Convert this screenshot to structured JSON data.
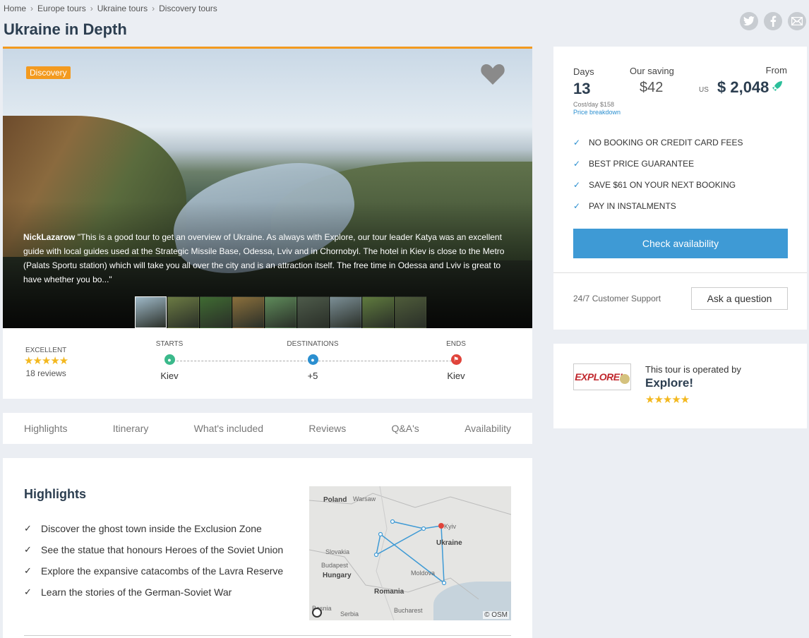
{
  "breadcrumb": [
    "Home",
    "Europe tours",
    "Ukraine tours",
    "Discovery tours"
  ],
  "page_title": "Ukraine in Depth",
  "social": [
    "twitter-icon",
    "facebook-icon",
    "email-icon"
  ],
  "hero": {
    "badge": "Discovery",
    "review_author": "NickLazarow",
    "review_text": "\"This is a good tour to get an overview of Ukraine. As always with Explore, our tour leader Katya was an excellent guide with local guides used at the Strategic Missile Base, Odessa, Lviv and in Chornobyl. The hotel in Kiev is close to the Metro (Palats Sportu station) which will take you all over the city and is an attraction itself. The free time in Odessa and Lviv is great to have whether you bo...\"",
    "thumbnail_colors": [
      "#9fb9c8",
      "#6b7a43",
      "#3f6a32",
      "#8a6f3c",
      "#5e8a5a",
      "#4d5a4a",
      "#7b8e95",
      "#5f7a3e",
      "#4e5b3a"
    ]
  },
  "info": {
    "rating_label": "EXCELLENT",
    "rating_value": 4.5,
    "stars": "★★★★★",
    "reviews_count": "18 reviews",
    "starts_label": "STARTS",
    "starts_value": "Kiev",
    "destinations_label": "DESTINATIONS",
    "destinations_value": "+5",
    "ends_label": "ENDS",
    "ends_value": "Kiev"
  },
  "tabs": [
    "Highlights",
    "Itinerary",
    "What's included",
    "Reviews",
    "Q&A's",
    "Availability"
  ],
  "highlights": {
    "title": "Highlights",
    "items": [
      "Discover the ghost town inside the Exclusion Zone",
      "See the statue that honours Heroes of the Soviet Union",
      "Explore the expansive catacombs of the Lavra Reserve",
      "Learn the stories of the German-Soviet War"
    ],
    "check": "✓"
  },
  "map": {
    "labels": [
      "Poland",
      "Warsaw",
      "Kyiv",
      "Ukraine",
      "Slovakia",
      "Budapest",
      "Hungary",
      "Moldova",
      "Romania",
      "Bucharest",
      "Serbia",
      "Bosnia"
    ],
    "attribution": "© OSM"
  },
  "price": {
    "days_label": "Days",
    "days": "13",
    "cost_per_day": "Cost/day $158",
    "breakdown": "Price breakdown",
    "saving_label": "Our saving",
    "saving": "$42",
    "from_label": "From",
    "currency": "US",
    "price": "$ 2,048",
    "perks": [
      "NO BOOKING OR CREDIT CARD FEES",
      "BEST PRICE GUARANTEE",
      "SAVE $61 ON YOUR NEXT BOOKING",
      "PAY IN INSTALMENTS"
    ],
    "check_availability": "Check availability",
    "support": "24/7 Customer Support",
    "ask": "Ask a question"
  },
  "operator": {
    "logo_text": "EXPLORE!",
    "intro": "This tour is operated by",
    "name": "Explore!",
    "stars": "★★★★★",
    "rating_value": 4.5
  },
  "colors": {
    "accent": "#f39a1f",
    "button_blue": "#3e9ad5",
    "start_pin": "#3bb98b",
    "dest_pin": "#2b8fd0",
    "end_pin": "#e0443b"
  }
}
